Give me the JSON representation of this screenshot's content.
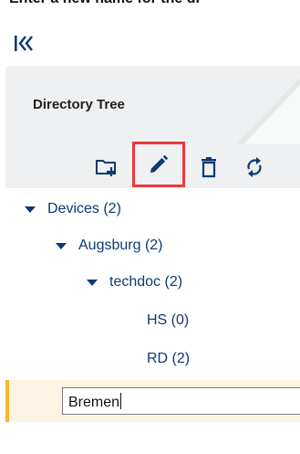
{
  "instruction": {
    "text": "Enter a new name for the di"
  },
  "colors": {
    "accent_blue": "#0b3a73",
    "highlight_red": "#e83a3f",
    "selection_marker": "#f5b82e",
    "panel_bg": "#eef0f1"
  },
  "panel": {
    "title": "Directory Tree"
  },
  "toolbar": {
    "icons": [
      "add-folder-icon",
      "rename-pencil-icon",
      "delete-trash-icon",
      "refresh-sync-icon"
    ],
    "highlighted": "rename-pencil-icon"
  },
  "tree": {
    "nodes": [
      {
        "label": "Devices (2)",
        "expanded": true
      },
      {
        "label": "Augsburg (2)",
        "expanded": true
      },
      {
        "label": "techdoc (2)",
        "expanded": true
      },
      {
        "label": "HS (0)"
      },
      {
        "label": "RD (2)"
      }
    ],
    "rename": {
      "value": "Bremen"
    }
  }
}
